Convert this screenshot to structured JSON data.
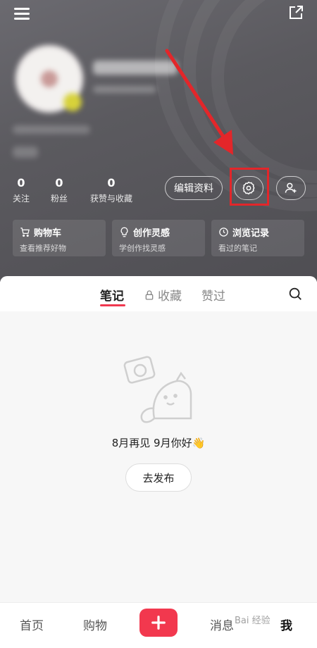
{
  "stats": [
    {
      "value": "0",
      "label": "关注"
    },
    {
      "value": "0",
      "label": "粉丝"
    },
    {
      "value": "0",
      "label": "获赞与收藏"
    }
  ],
  "actions": {
    "edit_profile": "编辑资料"
  },
  "cards": [
    {
      "title": "购物车",
      "subtitle": "查看推荐好物",
      "icon": "cart-icon"
    },
    {
      "title": "创作灵感",
      "subtitle": "学创作找灵感",
      "icon": "bulb-icon"
    },
    {
      "title": "浏览记录",
      "subtitle": "看过的笔记",
      "icon": "clock-icon"
    }
  ],
  "tabs": [
    {
      "label": "笔记",
      "active": true
    },
    {
      "label": "收藏",
      "icon": "lock-icon"
    },
    {
      "label": "赞过"
    }
  ],
  "empty_state": {
    "message": "8月再见 9月你好👋",
    "publish_button": "去发布"
  },
  "bottom_nav": [
    {
      "label": "首页"
    },
    {
      "label": "购物"
    },
    {
      "label": "消息"
    },
    {
      "label": "我",
      "active": true
    }
  ],
  "watermark": "Bai 经验",
  "colors": {
    "accent": "#f2384e",
    "highlight": "#e3262a",
    "header_bg": "#5b5a5f"
  }
}
